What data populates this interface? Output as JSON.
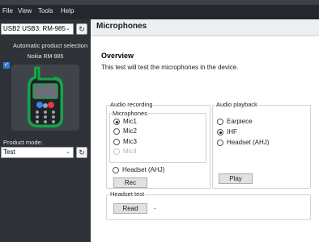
{
  "menu": [
    "File",
    "View",
    "Tools",
    "Help"
  ],
  "sidebar": {
    "connection_select_value": "USB2 USB3: RM-985",
    "auto_selection_label": "Automatic product selection",
    "auto_selection_checked": true,
    "device_name": "Nokia RM-985",
    "product_mode_label": "Product mode:",
    "product_mode_value": "Test"
  },
  "page": {
    "title": "Microphones",
    "overview_heading": "Overview",
    "overview_text": "This test will test the microphones in the device."
  },
  "audio_recording": {
    "group_title": "Audio recording",
    "microphones_title": "Microphones",
    "options": [
      {
        "label": "Mic1",
        "selected": true,
        "enabled": true
      },
      {
        "label": "Mic2",
        "selected": false,
        "enabled": true
      },
      {
        "label": "Mic3",
        "selected": false,
        "enabled": true
      },
      {
        "label": "Mic4",
        "selected": false,
        "enabled": false
      }
    ],
    "headset_label": "Headset (AHJ)",
    "rec_button": "Rec"
  },
  "audio_playback": {
    "group_title": "Audio playback",
    "options": [
      {
        "label": "Earpiece",
        "selected": false
      },
      {
        "label": "IHF",
        "selected": true
      },
      {
        "label": "Headset (AHJ)",
        "selected": false
      }
    ],
    "play_button": "Play"
  },
  "headset_test": {
    "group_title": "Headset test",
    "read_button": "Read",
    "result": "-"
  },
  "colors": {
    "sidebar_bg": "#2e3136",
    "menubar_bg": "#24272c",
    "phone_body": "#17a34a",
    "accent_check": "#2d7fd3"
  }
}
